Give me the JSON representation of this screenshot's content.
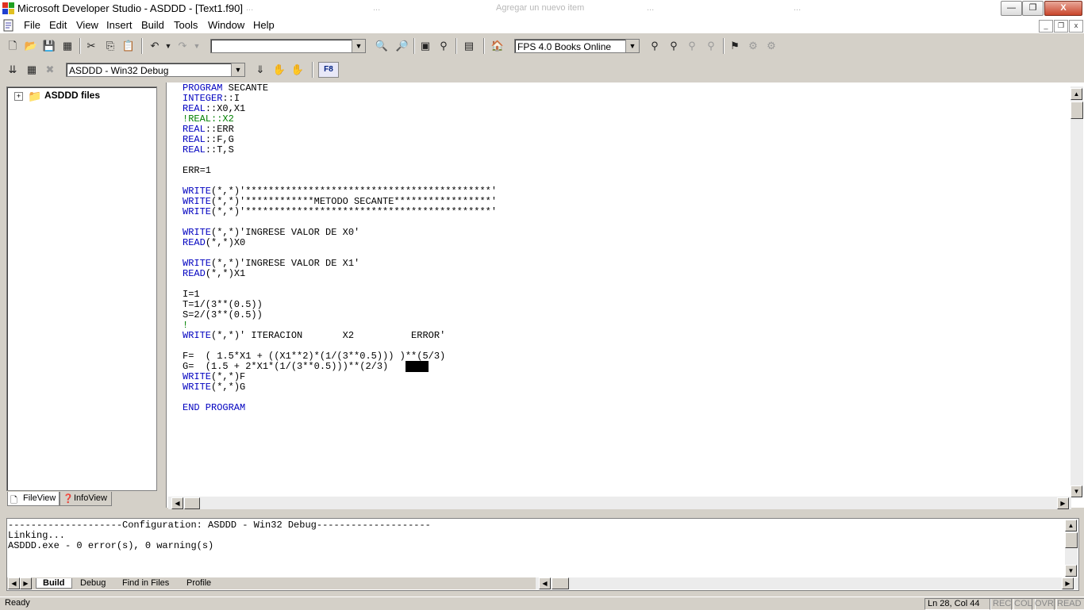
{
  "window": {
    "title": "Microsoft Developer Studio - ASDDD - [Text1.f90]",
    "ghost_tabs": [
      "...",
      "...",
      "Agregar un nuevo item",
      "...",
      "..."
    ],
    "controls": {
      "minimize": "—",
      "restore": "❐",
      "close": "X"
    }
  },
  "menu": [
    "File",
    "Edit",
    "View",
    "Insert",
    "Build",
    "Tools",
    "Window",
    "Help"
  ],
  "toolbar": {
    "find_combo_value": "",
    "books_online_combo_value": "FPS 4.0 Books Online",
    "config_combo_value": "ASDDD - Win32 Debug",
    "f8_label": "F8"
  },
  "workspace": {
    "root_label": "ASDDD files",
    "tabs": [
      "FileView",
      "InfoView"
    ]
  },
  "editor": {
    "lines": [
      [
        [
          "kw",
          "PROGRAM"
        ],
        [
          "t",
          " SECANTE"
        ]
      ],
      [
        [
          "kw",
          "INTEGER"
        ],
        [
          "t",
          "::I"
        ]
      ],
      [
        [
          "kw",
          "REAL"
        ],
        [
          "t",
          "::X0,X1"
        ]
      ],
      [
        [
          "cm",
          "!REAL::X2"
        ]
      ],
      [
        [
          "kw",
          "REAL"
        ],
        [
          "t",
          "::ERR"
        ]
      ],
      [
        [
          "kw",
          "REAL"
        ],
        [
          "t",
          "::F,G"
        ]
      ],
      [
        [
          "kw",
          "REAL"
        ],
        [
          "t",
          "::T,S"
        ]
      ],
      [
        [
          "t",
          ""
        ]
      ],
      [
        [
          "t",
          "ERR=1"
        ]
      ],
      [
        [
          "t",
          ""
        ]
      ],
      [
        [
          "kw",
          "WRITE"
        ],
        [
          "t",
          "(*,*)'*******************************************'"
        ]
      ],
      [
        [
          "kw",
          "WRITE"
        ],
        [
          "t",
          "(*,*)'************METODO SECANTE*****************'"
        ]
      ],
      [
        [
          "kw",
          "WRITE"
        ],
        [
          "t",
          "(*,*)'*******************************************'"
        ]
      ],
      [
        [
          "t",
          ""
        ]
      ],
      [
        [
          "kw",
          "WRITE"
        ],
        [
          "t",
          "(*,*)'INGRESE VALOR DE X0'"
        ]
      ],
      [
        [
          "kw",
          "READ"
        ],
        [
          "t",
          "(*,*)X0"
        ]
      ],
      [
        [
          "t",
          ""
        ]
      ],
      [
        [
          "kw",
          "WRITE"
        ],
        [
          "t",
          "(*,*)'INGRESE VALOR DE X1'"
        ]
      ],
      [
        [
          "kw",
          "READ"
        ],
        [
          "t",
          "(*,*)X1"
        ]
      ],
      [
        [
          "t",
          ""
        ]
      ],
      [
        [
          "t",
          "I=1"
        ]
      ],
      [
        [
          "t",
          "T=1/(3**(0.5))"
        ]
      ],
      [
        [
          "t",
          "S=2/(3**(0.5))"
        ]
      ],
      [
        [
          "cm",
          "!"
        ]
      ],
      [
        [
          "kw",
          "WRITE"
        ],
        [
          "t",
          "(*,*)' ITERACION       X2          ERROR'"
        ]
      ],
      [
        [
          "t",
          ""
        ]
      ],
      [
        [
          "t",
          "F=  ( 1.5*X1 + ((X1**2)*(1/(3**0.5))) )**(5/3)"
        ]
      ],
      [
        [
          "t",
          "G=  (1.5 + 2*X1*(1/(3**0.5)))**(2/3)   "
        ],
        [
          "sel",
          "    "
        ]
      ],
      [
        [
          "kw",
          "WRITE"
        ],
        [
          "t",
          "(*,*)F"
        ]
      ],
      [
        [
          "kw",
          "WRITE"
        ],
        [
          "t",
          "(*,*)G"
        ]
      ],
      [
        [
          "t",
          ""
        ]
      ],
      [
        [
          "kw",
          "END PROGRAM"
        ]
      ]
    ]
  },
  "output": {
    "lines": [
      "--------------------Configuration: ASDDD - Win32 Debug--------------------",
      "Linking...",
      "ASDDD.exe - 0 error(s), 0 warning(s)"
    ],
    "tabs": [
      "Build",
      "Debug",
      "Find in Files",
      "Profile"
    ]
  },
  "status": {
    "text": "Ready",
    "position": "Ln 28, Col 44",
    "indicators": [
      "REC",
      "COL",
      "OVR",
      "READ"
    ]
  }
}
